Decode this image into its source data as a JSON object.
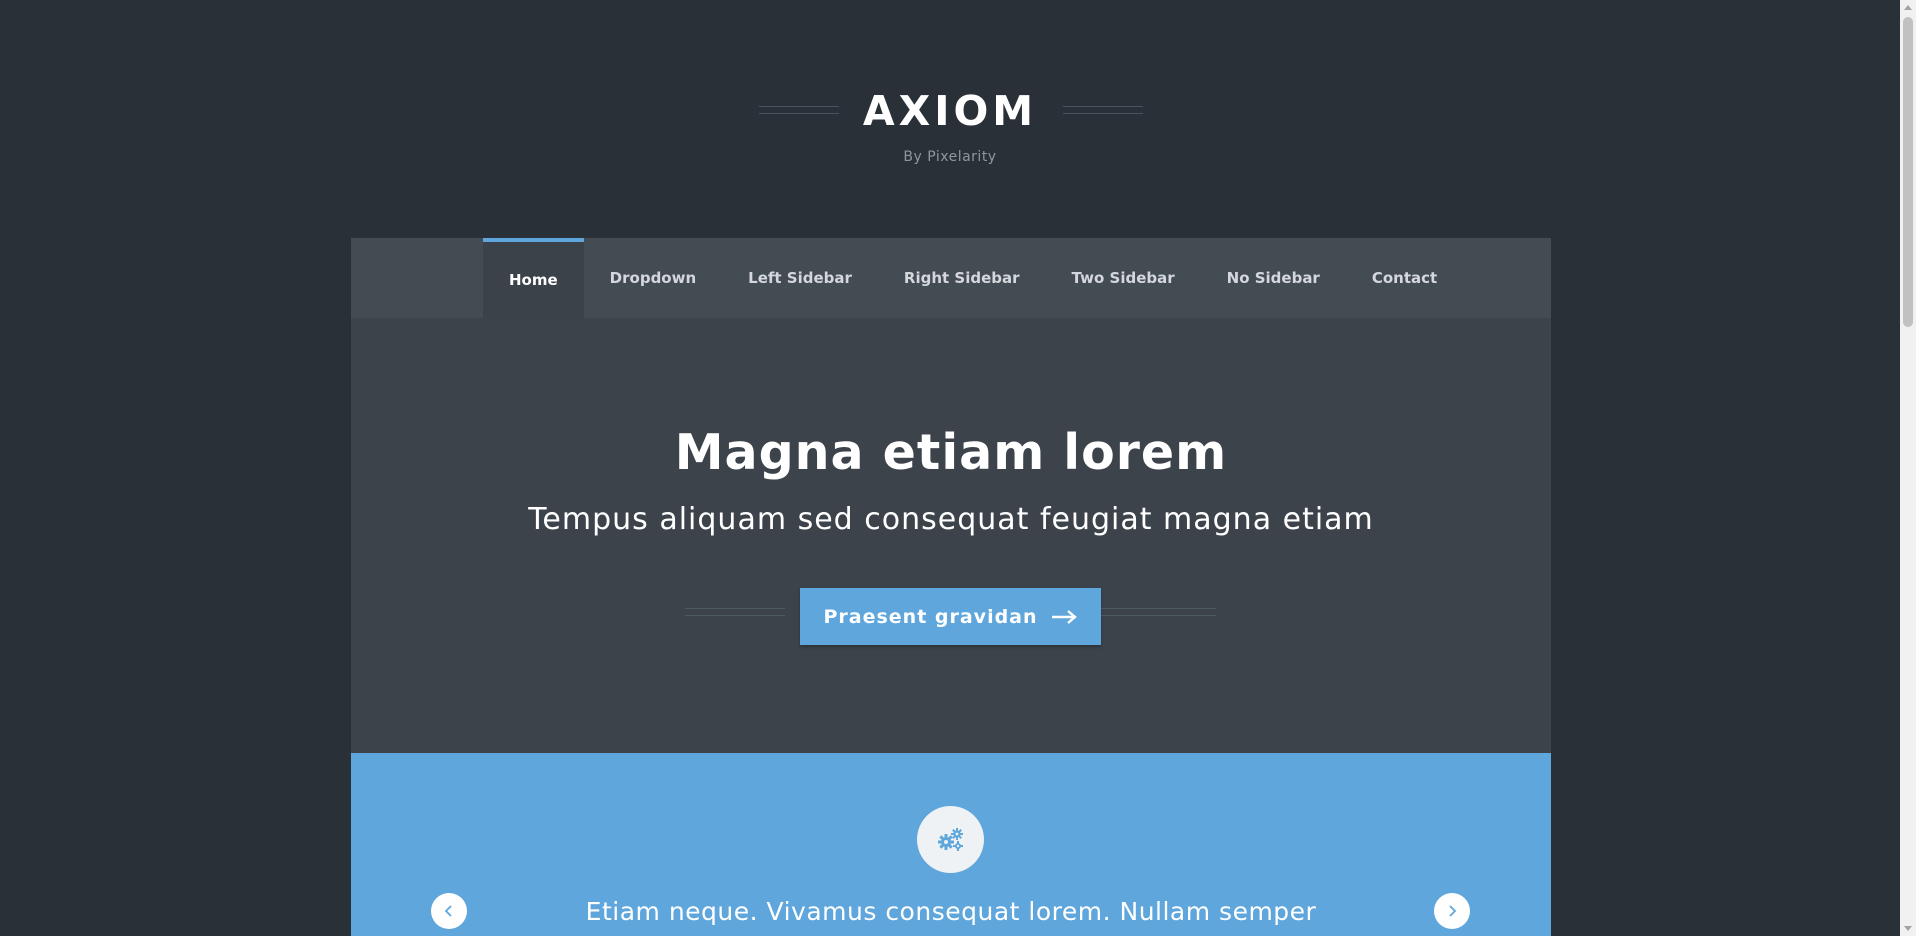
{
  "site": {
    "title": "AXIOM",
    "tagline": "By Pixelarity"
  },
  "nav": {
    "items": [
      {
        "label": "Home",
        "active": true
      },
      {
        "label": "Dropdown"
      },
      {
        "label": "Left Sidebar"
      },
      {
        "label": "Right Sidebar"
      },
      {
        "label": "Two Sidebar"
      },
      {
        "label": "No Sidebar"
      },
      {
        "label": "Contact"
      }
    ]
  },
  "hero": {
    "title": "Magna etiam lorem",
    "subtitle": "Tempus aliquam sed consequat feugiat magna etiam",
    "cta_label": "Praesent gravidan",
    "cta_icon": "arrow-right-icon"
  },
  "feature": {
    "icon": "gears-icon",
    "text": "Etiam neque. Vivamus consequat lorem. Nullam semper",
    "prev_icon": "chevron-left-icon",
    "next_icon": "chevron-right-icon"
  },
  "colors": {
    "background": "#2a3038",
    "nav": "#434b53",
    "hero": "#3c434b",
    "accent": "#5fa6dc"
  }
}
